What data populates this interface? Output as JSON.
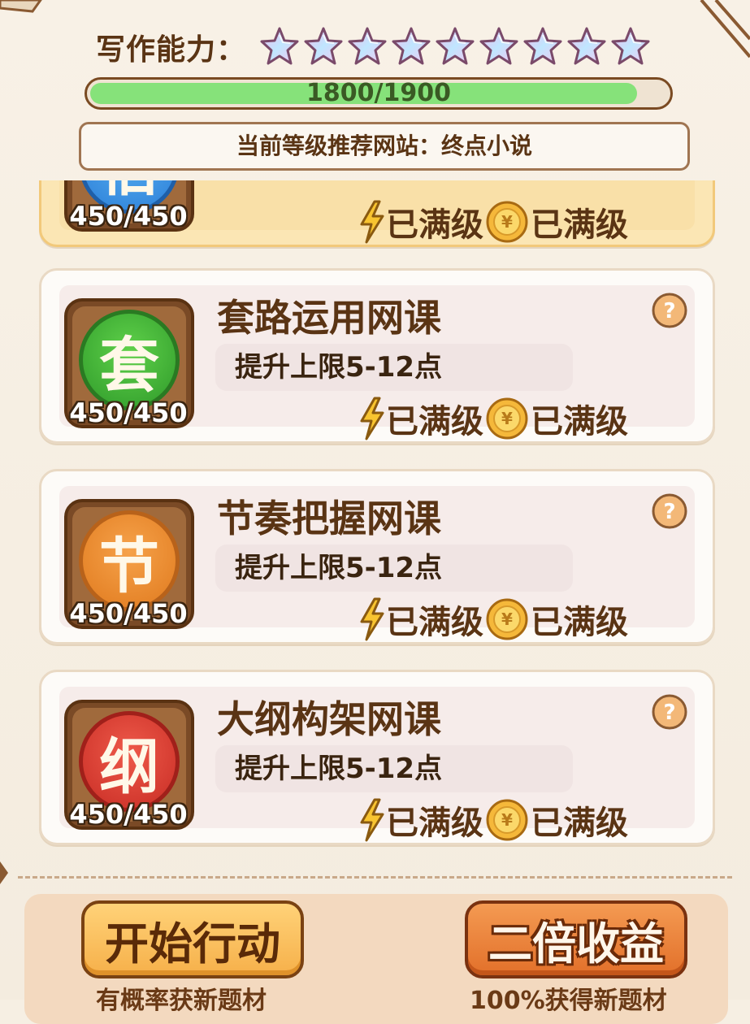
{
  "header": {
    "ability_label": "写作能力：",
    "star_count": 9,
    "progress_text": "1800/1900",
    "progress_current": 1800,
    "progress_max": 1900,
    "recommend_text": "当前等级推荐网站：终点小说"
  },
  "cards": [
    {
      "title": "",
      "icon_char": "宿",
      "icon_color": "blue",
      "count": "450/450",
      "desc": "",
      "energy_status": "已满级",
      "coin_status": "已满级",
      "highlighted": true
    },
    {
      "title": "套路运用网课",
      "icon_char": "套",
      "icon_color": "green",
      "count": "450/450",
      "desc": "提升上限5-12点",
      "energy_status": "已满级",
      "coin_status": "已满级"
    },
    {
      "title": "节奏把握网课",
      "icon_char": "节",
      "icon_color": "orange",
      "count": "450/450",
      "desc": "提升上限5-12点",
      "energy_status": "已满级",
      "coin_status": "已满级"
    },
    {
      "title": "大纲构架网课",
      "icon_char": "纲",
      "icon_color": "red",
      "count": "450/450",
      "desc": "提升上限5-12点",
      "energy_status": "已满级",
      "coin_status": "已满级"
    }
  ],
  "footer": {
    "start_button": "开始行动",
    "start_hint": "有概率获新题材",
    "double_button": "二倍收益",
    "double_hint": "100%获得新题材"
  },
  "colors": {
    "accent_green": "#86e27a",
    "text_brown": "#5a3414",
    "button_yellow": "#f6b04a",
    "button_orange": "#e2702a"
  }
}
